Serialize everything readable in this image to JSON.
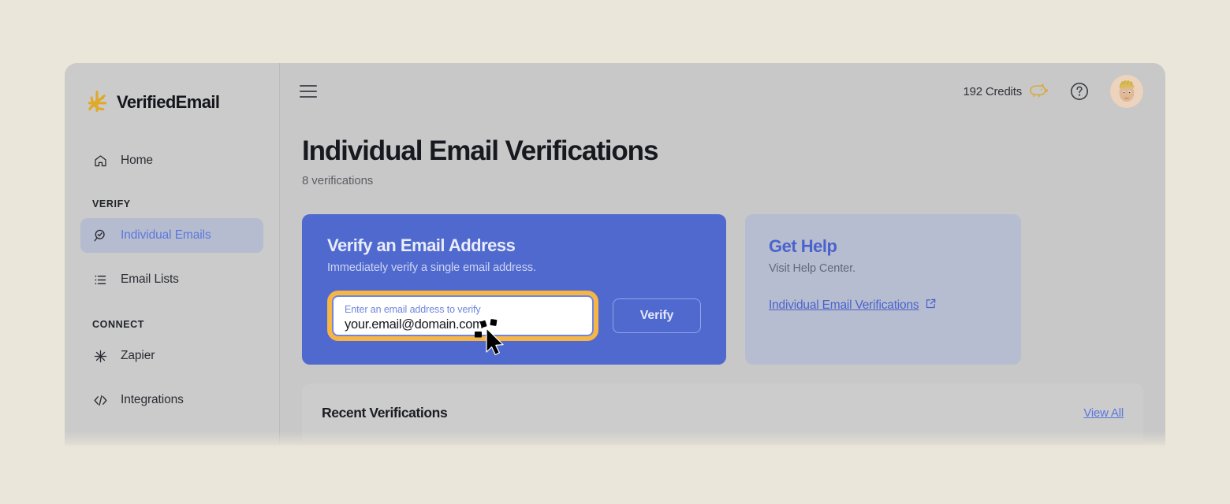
{
  "brand": {
    "name": "VerifiedEmail",
    "logo_icon": "starburst-icon",
    "logo_color": "#e0a92a"
  },
  "theme": {
    "page_background": "#ebe6da",
    "window_background": "#c8c8c8",
    "sidebar_background": "#cbcbcb",
    "accent_blue": "#5069cf",
    "highlight_orange": "#f6b545",
    "link_blue": "#5c77dd"
  },
  "sidebar": {
    "items": [
      {
        "label": "Home",
        "icon": "home-icon",
        "active": false
      },
      {
        "label": "Individual Emails",
        "icon": "search-check-icon",
        "active": true
      },
      {
        "label": "Email Lists",
        "icon": "list-icon",
        "active": false
      },
      {
        "label": "Zapier",
        "icon": "asterisk-icon",
        "active": false
      },
      {
        "label": "Integrations",
        "icon": "code-icon",
        "active": false
      }
    ],
    "sections": [
      {
        "label": "VERIFY"
      },
      {
        "label": "CONNECT"
      }
    ]
  },
  "topbar": {
    "menu_icon": "hamburger-icon",
    "credits_label": "192 Credits",
    "credits_icon": "piggy-bank-icon",
    "help_icon": "question-circle-icon",
    "avatar_icon": "user-avatar"
  },
  "page": {
    "title": "Individual Email Verifications",
    "subtitle": "8 verifications"
  },
  "verify_card": {
    "title": "Verify an Email Address",
    "subtitle": "Immediately verify a single email address.",
    "input_label": "Enter an email address to verify",
    "input_value": "your.email@domain.com",
    "input_placeholder": "Enter an email address to verify",
    "button_label": "Verify"
  },
  "help_card": {
    "title": "Get Help",
    "subtitle": "Visit Help Center.",
    "link_label": "Individual Email Verifications",
    "link_icon": "external-link-icon"
  },
  "recent": {
    "title": "Recent Verifications",
    "view_all_label": "View All"
  },
  "cursor": {
    "icon": "click-cursor-icon"
  }
}
